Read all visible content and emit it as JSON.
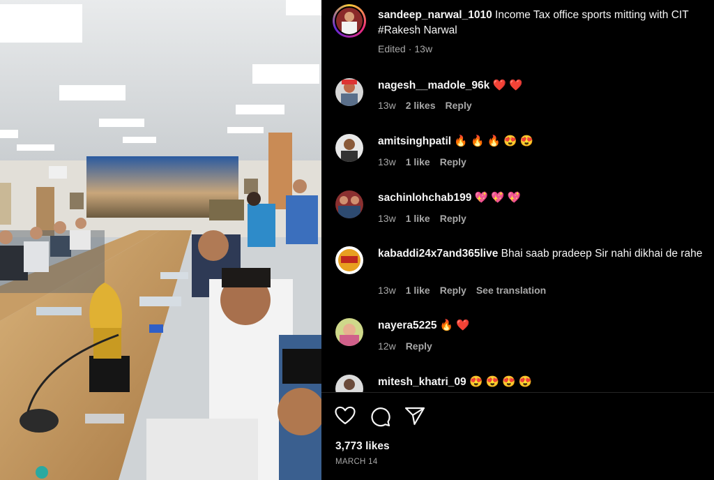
{
  "post": {
    "author": "sandeep_narwal_1010",
    "caption": "Income Tax office sports mitting with CIT #Rakesh Narwal",
    "edited": "Edited",
    "age": "13w"
  },
  "comments": [
    {
      "user": "nagesh__madole_96k",
      "text": "❤️ ❤️",
      "age": "13w",
      "likes": "2 likes",
      "reply": "Reply"
    },
    {
      "user": "amitsinghpatil",
      "text": "🔥 🔥 🔥 😍 😍",
      "age": "13w",
      "likes": "1 like",
      "reply": "Reply"
    },
    {
      "user": "sachinlohchab199",
      "text": "💖 💖 💖",
      "age": "13w",
      "likes": "1 like",
      "reply": "Reply"
    },
    {
      "user": "kabaddi24x7and365live",
      "text": "Bhai saab pradeep Sir nahi dikhai de rahe",
      "age": "13w",
      "likes": "1 like",
      "reply": "Reply",
      "translate": "See translation"
    },
    {
      "user": "nayera5225",
      "text": "🔥 ❤️",
      "age": "12w",
      "reply": "Reply"
    },
    {
      "user": "mitesh_khatri_09",
      "text": "😍 😍 😍 😍"
    }
  ],
  "actions": {
    "like_icon": "heart-icon",
    "comment_icon": "comment-icon",
    "share_icon": "send-icon"
  },
  "stats": {
    "likes": "3,773 likes",
    "date": "MARCH 14"
  },
  "colors": {
    "background": "#000000",
    "muted": "#a8a8a8",
    "heart": "#ff3040"
  }
}
